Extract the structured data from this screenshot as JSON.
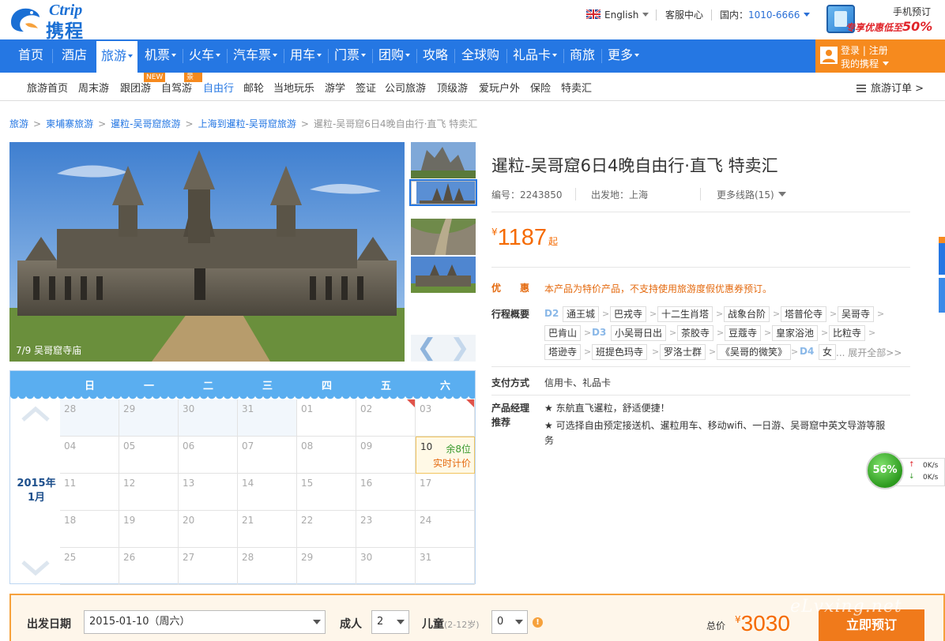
{
  "header": {
    "logo_en": "Ctrip",
    "logo_cn": "携程",
    "language": "English",
    "service": "客服中心",
    "domestic_label": "国内：",
    "domestic_phone": "1010-6666",
    "mobile_title": "手机预订",
    "mobile_promo": "专享优惠低至",
    "mobile_promo_pct": "50%"
  },
  "nav": {
    "items": [
      {
        "label": "首页"
      },
      {
        "label": "酒店"
      },
      {
        "label": "旅游"
      },
      {
        "label": "机票"
      },
      {
        "label": "火车"
      },
      {
        "label": "汽车票"
      },
      {
        "label": "用车"
      },
      {
        "label": "门票"
      },
      {
        "label": "团购"
      },
      {
        "label": "攻略"
      },
      {
        "label": "全球购"
      },
      {
        "label": "礼品卡"
      },
      {
        "label": "商旅"
      },
      {
        "label": "更多"
      }
    ],
    "login": "登录",
    "register": "注册",
    "my_ctrip": "我的携程"
  },
  "subnav": {
    "items": [
      {
        "label": "旅游首页"
      },
      {
        "label": "周末游"
      },
      {
        "label": "跟团游"
      },
      {
        "label": "自驾游"
      },
      {
        "label": "自由行"
      },
      {
        "label": "邮轮"
      },
      {
        "label": "当地玩乐"
      },
      {
        "label": "游学"
      },
      {
        "label": "签证"
      },
      {
        "label": "公司旅游"
      },
      {
        "label": "顶级游"
      },
      {
        "label": "爱玩户外"
      },
      {
        "label": "保险"
      },
      {
        "label": "特卖汇"
      }
    ],
    "badge_new": "NEW",
    "badge_hotel": "景+酒",
    "orders": "旅游订单"
  },
  "breadcrumb": {
    "c1": "旅游",
    "c2": "柬埔寨旅游",
    "c3": "暹粒-吴哥窟旅游",
    "c4": "上海到暹粒-吴哥窟旅游",
    "c5": "暹粒-吴哥窟6日4晚自由行·直飞 特卖汇"
  },
  "gallery": {
    "caption": "7/9 吴哥窟寺庙"
  },
  "calendar": {
    "weekdays": [
      "日",
      "一",
      "二",
      "三",
      "四",
      "五",
      "六"
    ],
    "year": "2015年",
    "month": "1月",
    "weeks": [
      [
        "28",
        "29",
        "30",
        "31",
        "01",
        "02",
        "03"
      ],
      [
        "04",
        "05",
        "06",
        "07",
        "08",
        "09",
        "10"
      ],
      [
        "11",
        "12",
        "13",
        "14",
        "15",
        "16",
        "17"
      ],
      [
        "18",
        "19",
        "20",
        "21",
        "22",
        "23",
        "24"
      ],
      [
        "25",
        "26",
        "27",
        "28",
        "29",
        "30",
        "31"
      ]
    ],
    "avail_remaining": "余8位",
    "avail_price": "实时计价"
  },
  "product": {
    "title": "暹粒-吴哥窟6日4晚自由行·直飞 特卖汇",
    "code_label": "编号：",
    "code": "2243850",
    "depart_label": "出发地：",
    "depart": "上海",
    "more_routes": "更多线路(15)",
    "price_currency": "¥",
    "price": "1187",
    "price_suffix": "起",
    "discount_label": "优　　惠",
    "discount_text": "本产品为特价产品，不支持使用旅游度假优惠券预订。",
    "itinerary_label": "行程概要",
    "itinerary": {
      "d2": "D2",
      "d3": "D3",
      "d4": "D4",
      "t1": "通王城",
      "t2": "巴戎寺",
      "t3": "十二生肖塔",
      "t4": "战象台阶",
      "t5": "塔普伦寺",
      "t6": "吴哥寺",
      "t7": "巴肯山",
      "t8": "小吴哥日出",
      "t9": "茶胶寺",
      "t10": "豆蔻寺",
      "t11": "皇家浴池",
      "t12": "比粒寺",
      "t13": "塔逊寺",
      "t14": "班提色玛寺",
      "t15": "罗洛士群",
      "t16": "《吴哥的微笑》",
      "t17": "女",
      "expand": "... 展开全部>>"
    },
    "payment_label": "支付方式",
    "payment": "信用卡、礼品卡",
    "manager_label_1": "产品经理",
    "manager_label_2": "推荐",
    "rec1": "★ 东航直飞暹粒，舒适便捷！",
    "rec2a": "★ 可选择自由预定接送机、暹粒用车、移动wifi、一日游、吴哥窟中英文导游等服",
    "rec2b": "务"
  },
  "speed_widget": {
    "percent": "56%",
    "up": "0K/s",
    "down": "0K/s"
  },
  "booking": {
    "date_label": "出发日期",
    "date_value": "2015-01-10（周六）",
    "adult_label": "成人",
    "adult_value": "2",
    "child_label": "儿童",
    "child_age": "(2-12岁)",
    "child_value": "0",
    "total_label": "总价",
    "total_currency": "¥",
    "total": "3030",
    "book_button": "立即预订"
  },
  "watermark": "eLvxing.net",
  "colors": {
    "brand_blue": "#2577e3",
    "accent_orange": "#f56a00",
    "login_orange": "#f68a1e"
  }
}
